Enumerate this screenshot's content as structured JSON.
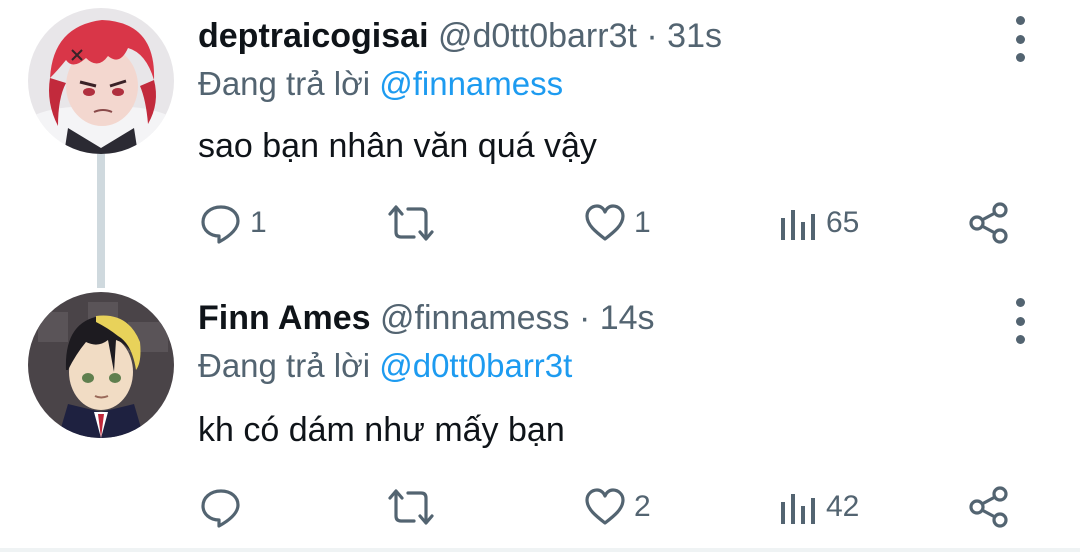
{
  "tweets": [
    {
      "author_name": "deptraicogisai",
      "handle": "@d0tt0barr3t",
      "separator": "·",
      "time": "31s",
      "reply_prefix": "Đang trả lời",
      "reply_to": "@finnamess",
      "text": "sao bạn nhân văn quá vậy",
      "reply_count": "1",
      "retweet_count": "",
      "like_count": "1",
      "view_count": "65",
      "avatar": "red-haired-anime-avatar"
    },
    {
      "author_name": "Finn Ames",
      "handle": "@finnamess",
      "separator": "·",
      "time": "14s",
      "reply_prefix": "Đang trả lời",
      "reply_to": "@d0tt0barr3t",
      "text": "kh có dám như mấy bạn",
      "reply_count": "",
      "retweet_count": "",
      "like_count": "2",
      "view_count": "42",
      "avatar": "blonde-anime-avatar"
    }
  ],
  "icons": {
    "reply": "reply-icon",
    "retweet": "retweet-icon",
    "like": "heart-icon",
    "views": "views-icon",
    "share": "share-icon",
    "more": "more-vertical-icon"
  },
  "colors": {
    "text_primary": "#0f1419",
    "text_secondary": "#536471",
    "mention": "#1d9bf0",
    "thread_line": "#cfd9de"
  }
}
